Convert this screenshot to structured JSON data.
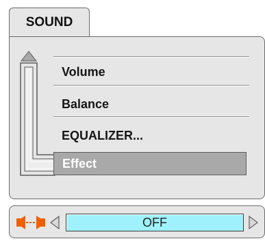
{
  "header": {
    "title": "SOUND"
  },
  "menu": {
    "items": [
      {
        "label": "Volume",
        "selected": false
      },
      {
        "label": "Balance",
        "selected": false
      },
      {
        "label": "EQUALIZER...",
        "selected": false
      },
      {
        "label": "Effect",
        "selected": true
      }
    ],
    "scroll_up_icon": "triangle-up-icon"
  },
  "setting": {
    "icon": "speaker-pair-icon",
    "value": "OFF",
    "prev_icon": "triangle-left-icon",
    "next_icon": "triangle-right-icon"
  },
  "colors": {
    "panel_bg": "#e6e6e6",
    "selected_bg": "#a9a9a9",
    "value_bg": "#9ff2fb",
    "speaker_icon": "#f06000"
  }
}
